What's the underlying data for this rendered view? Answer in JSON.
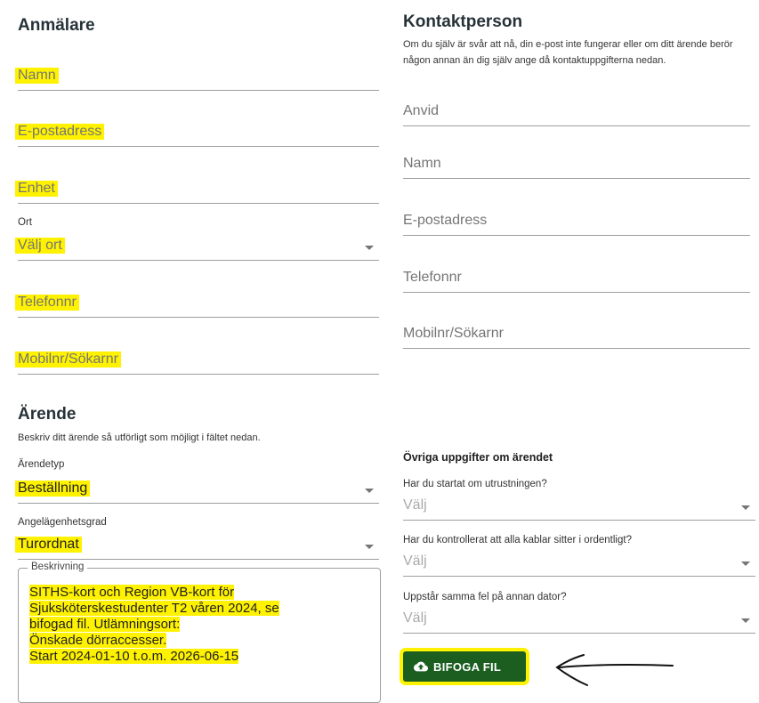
{
  "anmalare": {
    "title": "Anmälare",
    "fields": {
      "namn": "Namn",
      "epost": "E-postadress",
      "enhet": "Enhet",
      "ort_label": "Ort",
      "ort_value": "Välj ort",
      "telefon": "Telefonnr",
      "mobil": "Mobilnr/Sökarnr"
    }
  },
  "kontakt": {
    "title": "Kontaktperson",
    "desc": "Om du själv är svår att nå, din e-post inte fungerar eller om ditt ärende berör någon annan än dig själv ange då kontaktuppgifterna nedan.",
    "fields": {
      "anvid": "Anvid",
      "namn": "Namn",
      "epost": "E-postadress",
      "telefon": "Telefonnr",
      "mobil": "Mobilnr/Sökarnr"
    }
  },
  "arende": {
    "title": "Ärende",
    "desc": "Beskriv ditt ärende så utförligt som möjligt i fältet nedan.",
    "typ_label": "Ärendetyp",
    "typ_value": "Beställning",
    "grad_label": "Angelägenhetsgrad",
    "grad_value": "Turordnat",
    "beskrivning_label": "Beskrivning",
    "beskrivning_lines": [
      "SITHS-kort och Region VB-kort för",
      "Sjuksköterskestudenter T2 våren 2024, se",
      "bifogad fil. Utlämningsort:",
      "Önskade dörraccesser.",
      "Start 2024-01-10 t.o.m. 2026-06-15"
    ]
  },
  "ovriga": {
    "title": "Övriga uppgifter om ärendet",
    "q1_label": "Har du startat om utrustningen?",
    "q1_value": "Välj",
    "q2_label": "Har du kontrollerat att alla kablar sitter i ordentligt?",
    "q2_value": "Välj",
    "q3_label": "Uppstår samma fel på annan dator?",
    "q3_value": "Välj",
    "attach_label": "BIFOGA FIL"
  },
  "colors": {
    "highlight": "#fff200",
    "button": "#1b5e20"
  }
}
